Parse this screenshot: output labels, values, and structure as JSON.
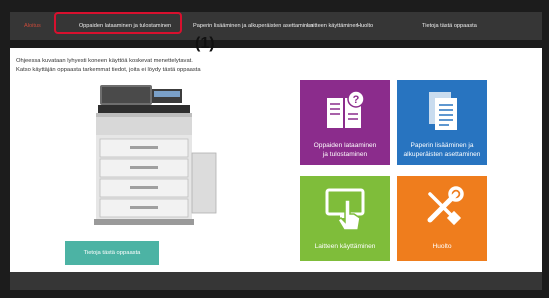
{
  "topbar": {
    "home_label": "Aloitus",
    "items": [
      "Oppaiden lataaminen ja tulostaminen",
      "Paperin lisääminen ja alkuperäisten asettaminen",
      "Laitteen käyttäminen",
      "Huolto",
      "Tietoja tästä oppaasta"
    ]
  },
  "callout": "(1)",
  "intro": {
    "line1": "Ohjeessa kuvataan lyhyesti koneen käyttöä koskevat menettelytavat.",
    "line2": "Katso käyttäjän oppaasta tarkemmat tiedot, joita ei löydy tästä oppaasta"
  },
  "guide_button": "Tietoja tästä oppaasta",
  "tiles": {
    "print": {
      "label1": "Oppaiden lataaminen",
      "label2": "ja tulostaminen",
      "color": "#8b2c8c"
    },
    "paper": {
      "label1": "Paperin lisääminen ja",
      "label2": "alkuperäisten asettaminen",
      "color": "#2874c0"
    },
    "operate": {
      "label1": "Laitteen käyttäminen",
      "color": "#7fbd3a"
    },
    "maint": {
      "label1": "Huolto",
      "color": "#ef7d1d"
    }
  },
  "icons": {
    "print": "document-question-icon",
    "paper": "documents-icon",
    "operate": "touch-screen-icon",
    "maint": "wrench-screwdriver-icon"
  }
}
